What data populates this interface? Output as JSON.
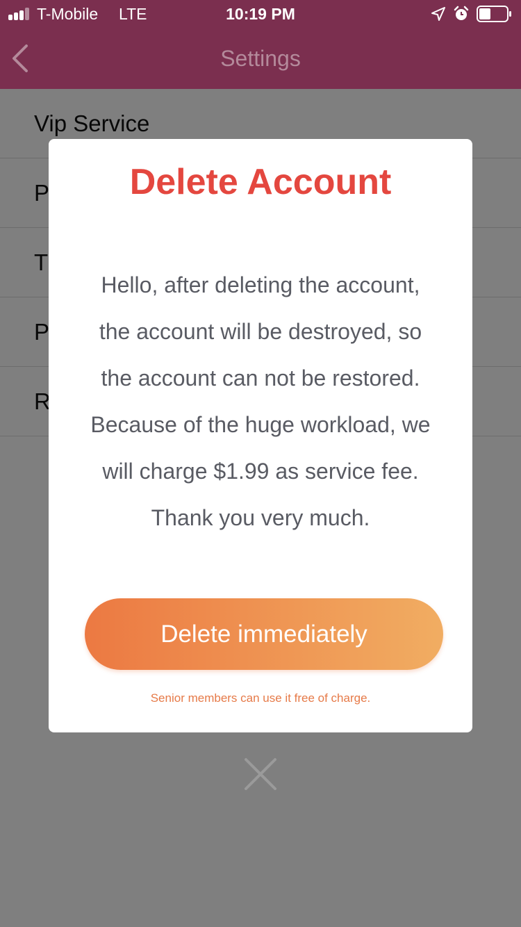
{
  "status_bar": {
    "carrier": "T-Mobile",
    "network": "LTE",
    "time": "10:19 PM",
    "icons": [
      "signal-icon",
      "location-arrow-icon",
      "alarm-clock-icon",
      "battery-icon"
    ]
  },
  "nav": {
    "title": "Settings",
    "back_icon": "chevron-left-icon"
  },
  "settings_list": {
    "items": [
      {
        "label": "Vip Service"
      },
      {
        "label": "P"
      },
      {
        "label": "T"
      },
      {
        "label": "P"
      },
      {
        "label": "R"
      }
    ]
  },
  "modal": {
    "title": "Delete Account",
    "body_lines": [
      "Hello, after deleting the account,",
      "the account will be destroyed, so",
      "the account can not be restored.",
      "Because of the huge workload, we",
      "will charge $1.99 as service fee.",
      "Thank you very much."
    ],
    "button_label": "Delete immediately",
    "note": "Senior members can use it free of charge.",
    "close_icon": "close-x-icon"
  },
  "colors": {
    "header_bg": "#7b2f4f",
    "title_red": "#e4473f",
    "button_gradient_start": "#ec7942",
    "button_gradient_end": "#f1ad62",
    "note_orange": "#e67a48"
  }
}
